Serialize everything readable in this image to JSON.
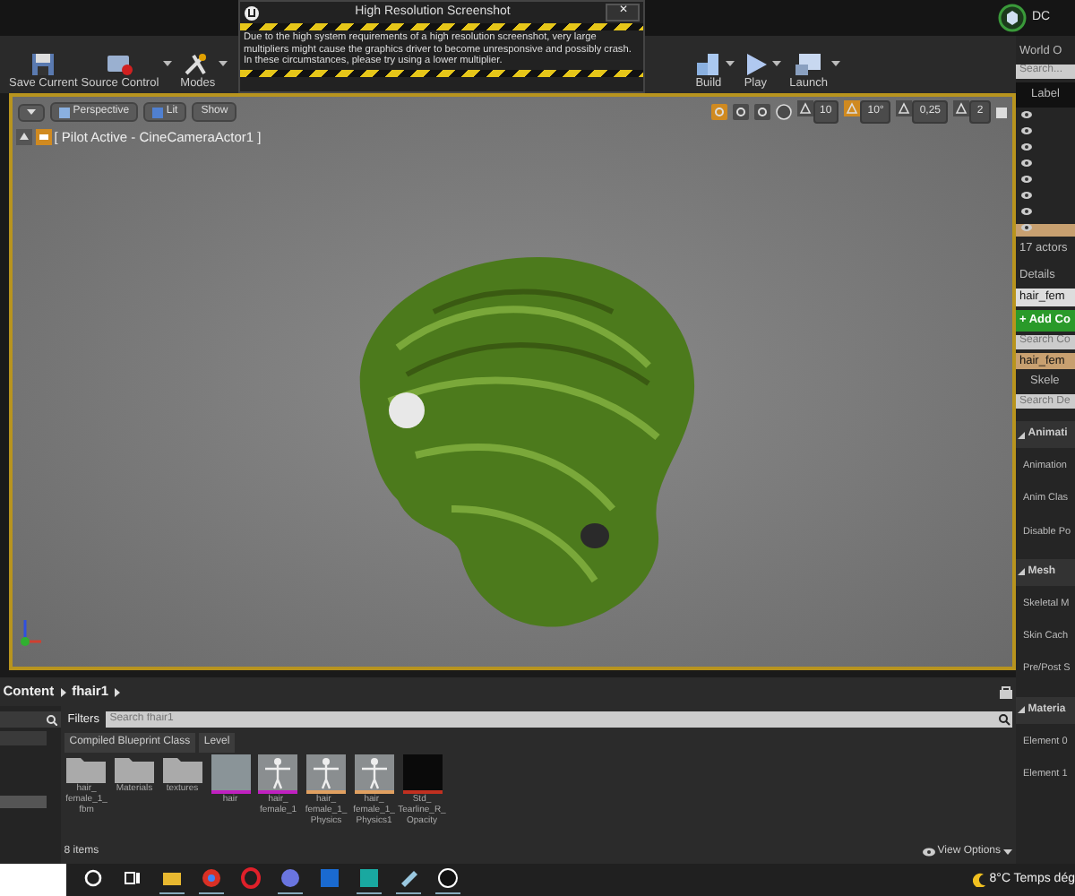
{
  "top_bar": {
    "right_label": "DC"
  },
  "dialog": {
    "title": "High Resolution Screenshot",
    "close": "✕",
    "message": "Due to the high system requirements of a high resolution screenshot, very large multipliers might cause the graphics driver to become unresponsive and possibly crash. In these circumstances, please try using a lower multiplier."
  },
  "toolbar": {
    "buttons": [
      {
        "kind": "save",
        "label": "Save Current",
        "dropdown": false
      },
      {
        "kind": "source",
        "label": "Source Control",
        "dropdown": true
      },
      {
        "kind": "modes",
        "label": "Modes",
        "dropdown": true
      },
      {
        "kind": "build",
        "label": "Build",
        "dropdown": true
      },
      {
        "kind": "play",
        "label": "Play",
        "dropdown": true
      },
      {
        "kind": "launch",
        "label": "Launch",
        "dropdown": true
      }
    ]
  },
  "viewport": {
    "view_buttons": [
      "Perspective",
      "Lit",
      "Show"
    ],
    "transform_modes": [
      {
        "selected": true
      },
      {
        "selected": false
      },
      {
        "selected": false
      }
    ],
    "snaps": [
      {
        "label": "10",
        "active": false
      },
      {
        "label": "10°",
        "active": true
      },
      {
        "label": "0,25",
        "active": false
      },
      {
        "label": "2",
        "active": false
      }
    ],
    "pilot_text": "[ Pilot Active - CineCameraActor1 ]"
  },
  "outliner": {
    "title": "World O",
    "search_placeholder": "Search...",
    "column": "Label",
    "rows": [
      {
        "selected": false
      },
      {
        "selected": false
      },
      {
        "selected": false
      },
      {
        "selected": false
      },
      {
        "selected": false
      },
      {
        "selected": false
      },
      {
        "selected": false
      },
      {
        "selected": true
      }
    ],
    "actor_count": "17 actors"
  },
  "details": {
    "title": "Details",
    "name_value": "hair_fem",
    "add_button": "+ Add Co",
    "components_search": {
      "placeholder": "Search Co"
    },
    "components": [
      {
        "label": "hair_fem",
        "selected": true
      },
      {
        "label": "Skele",
        "selected": false
      }
    ],
    "details_search": {
      "placeholder": "Search De"
    },
    "sections": [
      {
        "title": "Animati",
        "rows": [
          "Animation",
          "Anim Clas",
          "Disable Po"
        ]
      },
      {
        "title": "Mesh",
        "rows": [
          "Skeletal M",
          "Skin Cach",
          "Pre/Post S"
        ]
      },
      {
        "title": "Materia",
        "rows": [
          "Element 0",
          "Element 1"
        ]
      }
    ]
  },
  "content_browser": {
    "breadcrumb": [
      "Content",
      "fhair1"
    ],
    "filters": "Filters",
    "search_placeholder": "Search fhair1",
    "filter_tags": [
      "Compiled Blueprint Class",
      "Level"
    ],
    "assets": [
      {
        "kind": "folder",
        "name": "hair_ female_1_ fbm"
      },
      {
        "kind": "folder",
        "name": "Materials"
      },
      {
        "kind": "folder",
        "name": "textures"
      },
      {
        "kind": "level",
        "name": "hair",
        "color": "#c020c0"
      },
      {
        "kind": "figure",
        "name": "hair_ female_1",
        "color": "#c020c0"
      },
      {
        "kind": "figure",
        "name": "hair_ female_1_ Physics",
        "color": "#e0a060"
      },
      {
        "kind": "figure",
        "name": "hair_ female_1_ Physics1",
        "color": "#e0a060"
      },
      {
        "kind": "texture",
        "name": "Std_ Tearline_R_ Opacity",
        "color": "#c03020"
      }
    ],
    "item_count": "8 items",
    "view_options": "View Options"
  },
  "taskbar": {
    "apps": [
      {
        "kind": "cortana",
        "open": false
      },
      {
        "kind": "taskview",
        "open": false
      },
      {
        "kind": "explorer",
        "open": true
      },
      {
        "kind": "chrome",
        "open": true
      },
      {
        "kind": "opera",
        "open": false
      },
      {
        "kind": "discord",
        "open": true
      },
      {
        "kind": "photos",
        "open": false
      },
      {
        "kind": "m",
        "open": true
      },
      {
        "kind": "notes",
        "open": true
      },
      {
        "kind": "unreal",
        "open": true
      }
    ],
    "temperature": "8°C",
    "weather_text": "Temps dég"
  }
}
